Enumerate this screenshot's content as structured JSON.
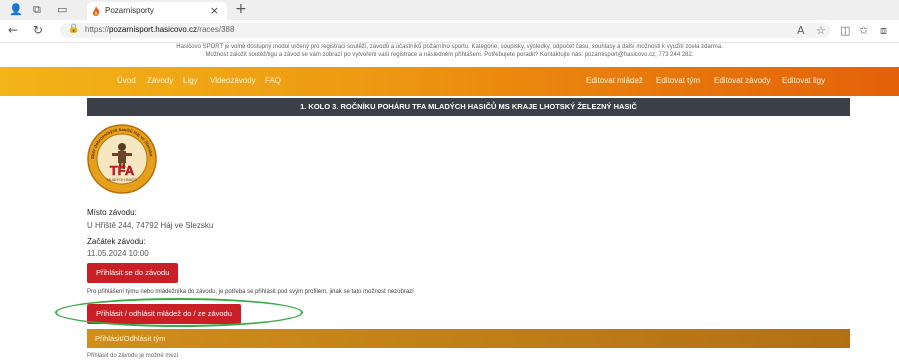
{
  "browser": {
    "tab_title": "Pozarnisporty",
    "url_prefix": "https://",
    "url_host": "pozarnisport.hasicovo.cz",
    "url_path": "/races/388",
    "new_tab": "+",
    "close": "×"
  },
  "notice": {
    "line1": "Hasičovo SPORT je volně dostupný modul určený pro registraci soutěží, závodů a účastníků požárního sportu. Kategorie, soupisky, výsledky, odpočet času, souhlasy a další možnosti k využití zcela zdarma.",
    "line2": "Možnost založit soutěž/ligu a závod se vám zobrazí po vytvoření vaší registrace a následném přihlášení. Potřebujete poradit? Kontaktujte nás: pozarnisport@hasicovo.cz, 773 244 282."
  },
  "nav": {
    "left": [
      "Úvod",
      "Závody",
      "Ligy",
      "Videozávody",
      "FAQ"
    ],
    "right": [
      "Editovat mládež",
      "Editovat tým",
      "Editovat závody",
      "Editovat ligy"
    ]
  },
  "race": {
    "title": "1. KOLO 3. ROČNÍKU POHÁRU TFA MLADÝCH HASIČŮ MS KRAJE LHOTSKÝ ŽELEZNÝ HASIČ",
    "logo_text": "TFA",
    "logo_ring_text": "Sbor dobrovolných hasičů Háj ve Slezsku",
    "logo_sub": "MLADÝCH HASIČŮ",
    "place_label": "Místo závodu:",
    "place_value": "U Hřiště 244, 74792 Háj ve Slezsku",
    "start_label": "Začátek závodu:",
    "start_value": "11.05.2024 10:00",
    "register_button": "Přihlásit se do závodu",
    "register_note": "Pro přihlášení týmu nebo mládežníka do závodu, je potřeba se přihlásit pod svým profilem, jinak se tato možnost nezobrazí",
    "youth_button": "Přihlásit / odhlásit mládež do / ze závodu",
    "team_section": "Přihlásit/Odhlásit tým",
    "cut_text": "Přihlásit do závodu je možné mezi"
  },
  "colors": {
    "nav_gradient_start": "#f2b418",
    "nav_gradient_end": "#e4610a",
    "title_bar": "#3b4048",
    "button_red": "#c92027",
    "highlight_green": "#3aab47",
    "team_bar": "#c0801a"
  },
  "icons": {
    "profile": "profile-icon",
    "workspaces": "workspaces-icon",
    "tab_actions": "tab-actions-icon",
    "back": "back-arrow-icon",
    "reload": "reload-icon",
    "lock": "lock-icon",
    "read_aloud": "read-aloud-icon",
    "favorite": "star-icon",
    "split": "split-screen-icon",
    "favorites_bar": "favorites-icon",
    "collections": "collections-icon"
  }
}
